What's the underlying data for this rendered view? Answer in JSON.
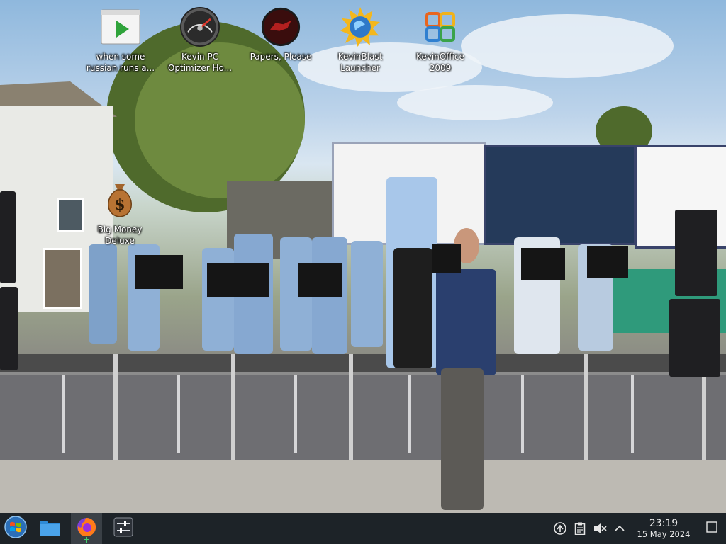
{
  "desktop": {
    "icons": [
      {
        "label": "when some russian runs a...",
        "icon": "video-file-icon"
      },
      {
        "label": "Kevin PC Optimizer Ho...",
        "icon": "gauge-icon"
      },
      {
        "label": "Papers, Please",
        "icon": "papers-please-icon"
      },
      {
        "label": "KevinBlast Launcher",
        "icon": "globe-sun-icon"
      },
      {
        "label": "KevinOffice 2009",
        "icon": "office-icon"
      },
      {
        "label": "Big Money Deluxe",
        "icon": "money-bag-icon"
      }
    ]
  },
  "taskbar": {
    "start_icon": "windows-start-icon",
    "pinned": [
      {
        "name": "file-manager",
        "icon": "folder-icon",
        "active": false
      },
      {
        "name": "firefox",
        "icon": "firefox-icon",
        "active": true
      },
      {
        "name": "settings",
        "icon": "sliders-icon",
        "active": false
      }
    ],
    "tray": {
      "icons": [
        "network-icon",
        "clipboard-icon",
        "volume-muted-icon",
        "chevron-up-icon"
      ],
      "time": "23:19",
      "date": "15 May 2024"
    }
  }
}
